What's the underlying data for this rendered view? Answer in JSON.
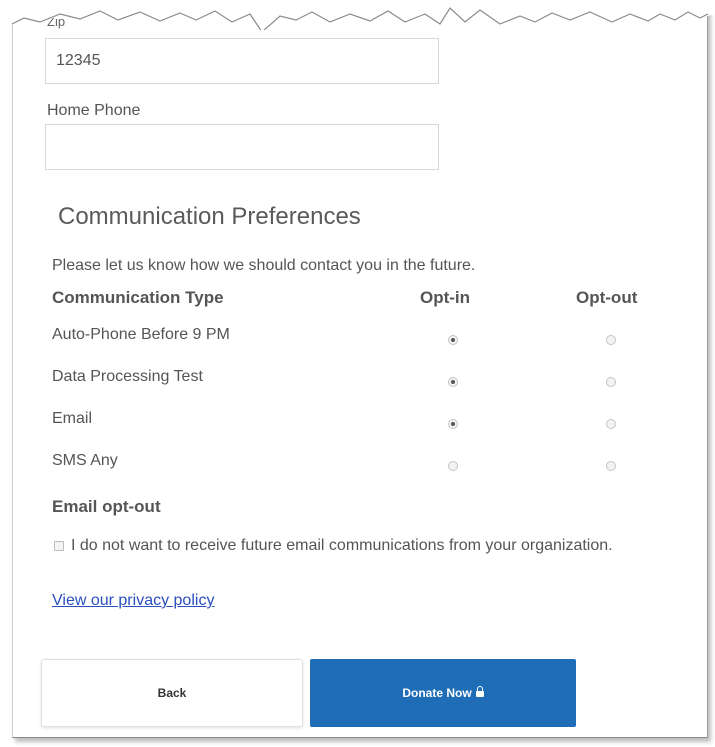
{
  "top_partial_label": "Zip",
  "zip": {
    "value": "12345"
  },
  "home_phone": {
    "label": "Home Phone",
    "value": ""
  },
  "communication": {
    "title": "Communication Preferences",
    "intro": "Please let us know how we should contact you in the future.",
    "headers": {
      "type": "Communication Type",
      "opt_in": "Opt-in",
      "opt_out": "Opt-out"
    },
    "rows": [
      {
        "label": "Auto-Phone Before 9 PM",
        "selected": "opt-in"
      },
      {
        "label": "Data Processing Test",
        "selected": "opt-in"
      },
      {
        "label": "Email",
        "selected": "opt-in"
      },
      {
        "label": "SMS Any",
        "selected": "none"
      }
    ]
  },
  "email_optout": {
    "title": "Email opt-out",
    "checkbox_text": "I do not want to receive future email communications from your organization.",
    "checked": false
  },
  "privacy_link": "View our privacy policy",
  "buttons": {
    "back": "Back",
    "donate": "Donate Now"
  },
  "colors": {
    "primary": "#1f6cb7",
    "link": "#2b4fbf",
    "text": "#555555"
  }
}
